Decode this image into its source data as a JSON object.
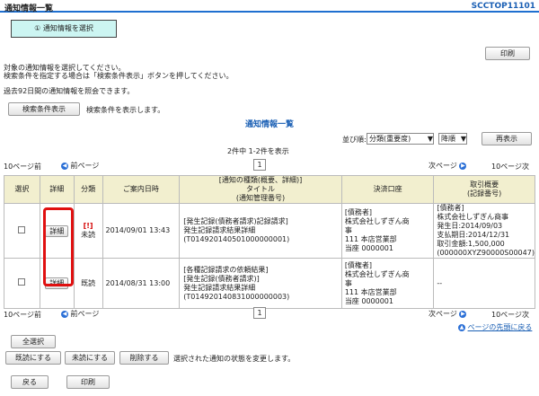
{
  "header": {
    "title": "通知情報一覧",
    "screen_code": "SCCTOP11101"
  },
  "step": {
    "label": "① 通知情報を選択"
  },
  "actions": {
    "print_top": "印刷",
    "print_bottom": "印刷",
    "back": "戻る"
  },
  "instructions": {
    "line1": "対象の通知情報を選択してください。",
    "line2": "検索条件を指定する場合は「検索条件表示」ボタンを押してください。",
    "line3": "過去92日間の通知情報を照会できます。"
  },
  "search": {
    "button": "検索条件表示",
    "hint": "検索条件を表示します。"
  },
  "list_title": "通知情報一覧",
  "sort": {
    "label": "並び順:",
    "field": "分類(重要度)",
    "order": "降順",
    "button": "再表示"
  },
  "count_text": "2件中 1-2件を表示",
  "pager": {
    "prev10": "10ページ前",
    "prev": "前ページ",
    "page": "1",
    "next": "次ページ",
    "next10": "10ページ次",
    "to_top": "ページの先頭に戻る"
  },
  "table": {
    "headers": [
      "選択",
      "詳細",
      "分類",
      "ご案内日時",
      "[通知の種類(概要、詳細)]\nタイトル\n(通知管理番号)",
      "決済口座",
      "取引概要\n(記録番号)"
    ],
    "detail_label": "詳細",
    "rows": [
      {
        "tag": "[!]",
        "status": "未読",
        "date": "2014/09/01 13:43",
        "notice_l1": "[発生記録(債務者請求)記録請求]",
        "notice_l2": "発生記録請求結果詳細",
        "notice_l3": "(T014920140501000000001)",
        "acct_l1": "[債務者]",
        "acct_l2": "株式会社しずぎん商",
        "acct_l3": "事",
        "acct_l4": "111 本店営業部",
        "acct_l5": "当座 0000001",
        "tx_l1": "[債務者]",
        "tx_l2": "株式会社しずぎん商事",
        "tx_l3": "発生日:2014/09/03",
        "tx_l4": "支払期日:2014/12/31",
        "tx_l5": "取引金額:1,500,000",
        "tx_l6": "(000000XYZ90000S00047)"
      },
      {
        "tag": "",
        "status": "既読",
        "date": "2014/08/31 13:00",
        "notice_l1": "[各種記録請求の依頼結果]",
        "notice_l2": "[発生記録(債務者請求)]",
        "notice_l3": "発生記録請求結果詳細",
        "notice_l4": "(T014920140831000000003)",
        "acct_l1": "[債権者]",
        "acct_l2": "株式会社しずぎん商",
        "acct_l3": "事",
        "acct_l4": "111 本店営業部",
        "acct_l5": "当座 0000001",
        "tx_l1": "--"
      }
    ]
  },
  "bulk": {
    "select_all": "全選択",
    "mark_read": "既読にする",
    "mark_unread": "未読にする",
    "delete": "削除する",
    "hint": "選択された通知の状態を変更します。"
  },
  "colors": {
    "accent_blue": "#1a5fb4",
    "header_bg": "#f2efcf",
    "step_bg": "#ccf5f2",
    "highlight_red": "#e01010"
  }
}
